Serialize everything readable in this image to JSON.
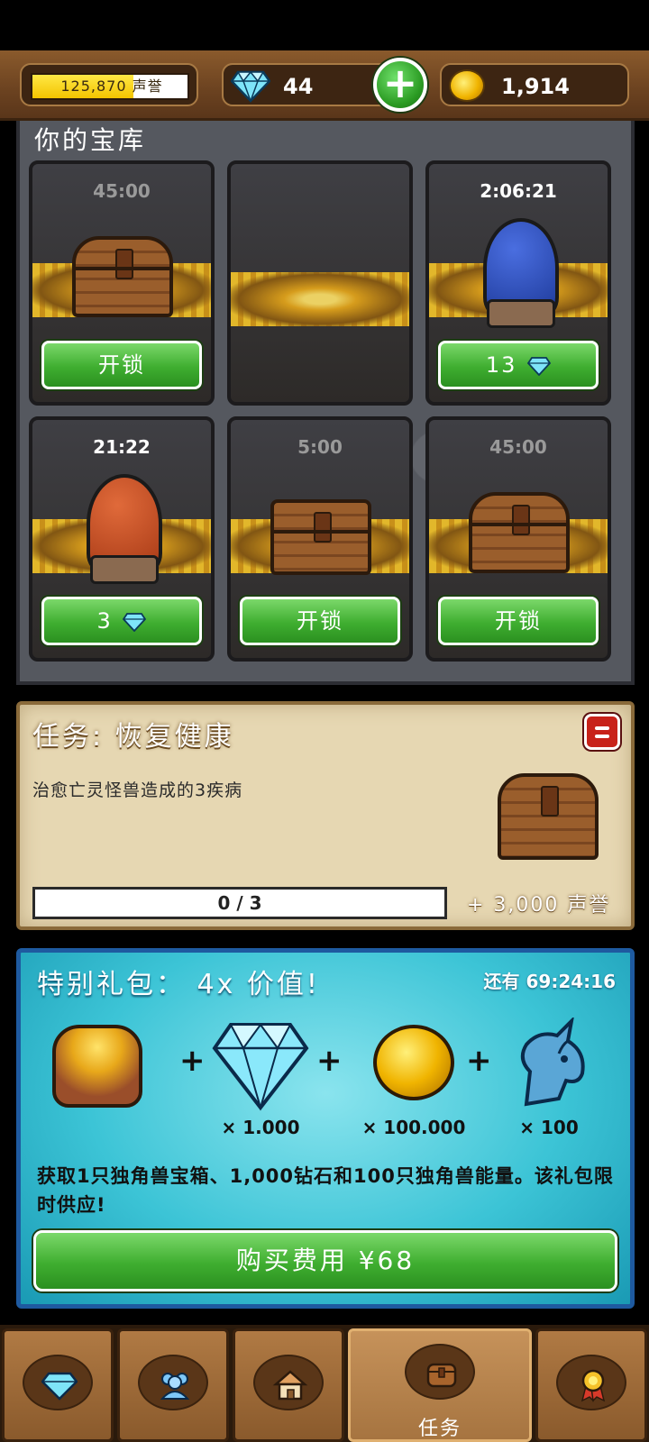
{
  "header": {
    "reputation": "125,870 声誉",
    "reputation_progress": 0.65,
    "gems": "44",
    "coins": "1,914",
    "icons": {
      "gem": "diamond-icon",
      "add": "plus-icon",
      "coin": "gold-coin-icon"
    }
  },
  "vault": {
    "title": "你的宝库",
    "slots": [
      {
        "timer": "45:00",
        "button": "开锁"
      },
      {
        "timer": "",
        "button": ""
      },
      {
        "timer": "2:06:21",
        "button": "13"
      },
      {
        "timer": "21:22",
        "button": "3"
      },
      {
        "timer": "5:00",
        "button": "开锁"
      },
      {
        "timer": "45:00",
        "button": "开锁"
      }
    ]
  },
  "quest": {
    "title": "任务: 恢复健康",
    "description": "治愈亡灵怪兽造成的3疾病",
    "progress_text": "0 / 3",
    "progress": 0,
    "reward": "+ 3,000 声誉"
  },
  "special_pack": {
    "title": "特别礼包： 4x 价值!",
    "timer": "还有 69:24:16",
    "items": [
      {
        "icon": "unicorn-chest-icon",
        "qty": ""
      },
      {
        "icon": "diamond-icon",
        "qty": "× 1.000"
      },
      {
        "icon": "gold-coin-icon",
        "qty": "× 100.000"
      },
      {
        "icon": "unicorn-icon",
        "qty": "× 100"
      }
    ],
    "plus": "+",
    "description": "获取1只独角兽宝箱、1,000钻石和100只独角兽能量。该礼包限时供应!",
    "buy_label": "购买费用 ¥68"
  },
  "bottom_nav": {
    "tabs": [
      {
        "icon": "diamond-icon",
        "label": ""
      },
      {
        "icon": "people-icon",
        "label": ""
      },
      {
        "icon": "house-icon",
        "label": ""
      },
      {
        "icon": "chest-icon",
        "label": "任务"
      },
      {
        "icon": "medal-icon",
        "label": ""
      }
    ]
  }
}
